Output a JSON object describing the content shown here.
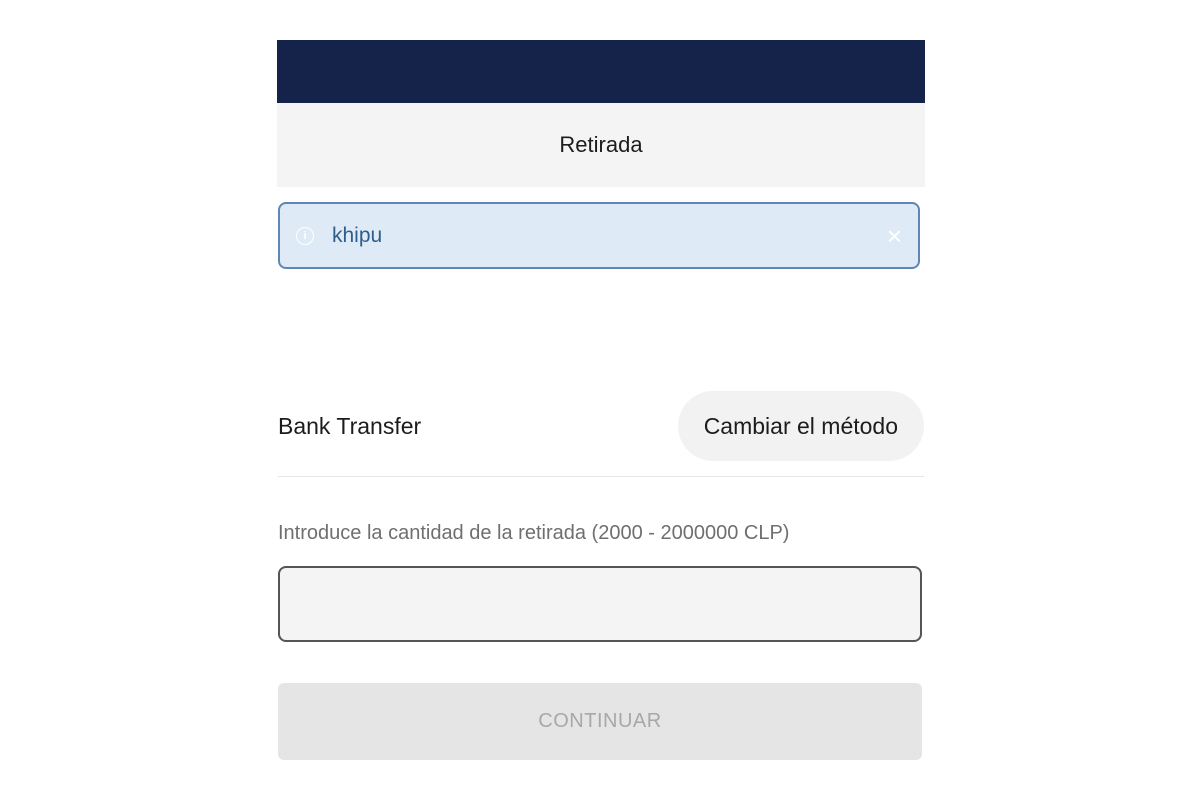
{
  "header": {
    "title": "Retirada"
  },
  "alert": {
    "icon": "info-icon",
    "text": "khipu",
    "close_icon": "close-icon"
  },
  "method": {
    "name": "Bank Transfer",
    "change_label": "Cambiar el método"
  },
  "amount": {
    "label": "Introduce la cantidad de la retirada (2000 - 2000000 CLP)",
    "value": "",
    "placeholder": ""
  },
  "actions": {
    "continue_label": "CONTINUAR"
  },
  "colors": {
    "topbar": "#15224a",
    "alert_bg": "#deebf6",
    "alert_border": "#5f86b4",
    "alert_text": "#2f5e8c"
  }
}
